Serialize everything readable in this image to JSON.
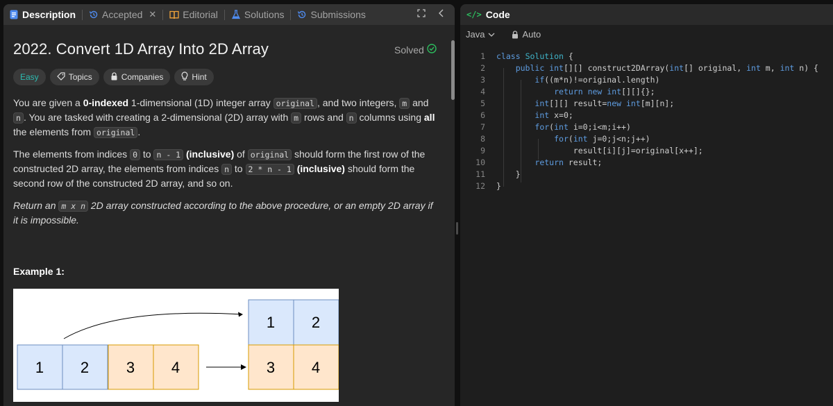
{
  "tabs": [
    {
      "label": "Description",
      "icon": "description-icon",
      "active": true
    },
    {
      "label": "Accepted",
      "icon": "history-icon",
      "active": false
    },
    {
      "label": "Editorial",
      "icon": "book-icon",
      "active": false
    },
    {
      "label": "Solutions",
      "icon": "flask-icon",
      "active": false
    },
    {
      "label": "Submissions",
      "icon": "history-icon",
      "active": false
    }
  ],
  "close_glyph": "✕",
  "problem": {
    "title": "2022. Convert 1D Array Into 2D Array",
    "status": "Solved",
    "chips": [
      "Easy",
      "Topics",
      "Companies",
      "Hint"
    ],
    "p1": {
      "t1": "You are given a ",
      "b1": "0-indexed",
      "t2": " 1-dimensional (1D) integer array ",
      "c1": "original",
      "t3": ", and two integers, ",
      "c2": "m",
      "t4": " and ",
      "c3": "n",
      "t5": ". You are tasked with creating a 2-dimensional (2D) array with ",
      "c4": "m",
      "t6": " rows and ",
      "c5": "n",
      "t7": " columns using ",
      "b2": "all",
      "t8": " the elements from ",
      "c6": "original",
      "t9": "."
    },
    "p2": {
      "t1": "The elements from indices ",
      "c1": "0",
      "t2": " to ",
      "c2": "n - 1",
      "t3": " ",
      "b1": "(inclusive)",
      "t4": " of ",
      "c3": "original",
      "t5": " should form the first row of the constructed 2D array, the elements from indices ",
      "c4": "n",
      "t6": " to ",
      "c5": "2 * n - 1",
      "t7": " ",
      "b2": "(inclusive)",
      "t8": " should form the second row of the constructed 2D array, and so on."
    },
    "p3": {
      "t1": "Return an ",
      "c1": "m x n",
      "t2": " 2D array constructed according to the above procedure, or an empty 2D array if it is impossible."
    },
    "example_title": "Example 1:",
    "example_image": {
      "input_cells": [
        "1",
        "2",
        "3",
        "4"
      ],
      "output_rows": [
        [
          "1",
          "2"
        ],
        [
          "3",
          "4"
        ]
      ],
      "colors": {
        "blue": "#dae8fc",
        "blue_border": "#6c8ebf",
        "orange": "#ffe6cc",
        "orange_border": "#d79b00"
      }
    }
  },
  "code_panel": {
    "title": "Code",
    "language": "Java",
    "mode": "Auto",
    "line_numbers": [
      "1",
      "2",
      "3",
      "4",
      "5",
      "6",
      "7",
      "8",
      "9",
      "10",
      "11",
      "12"
    ]
  },
  "colors": {
    "accent_green": "#2cbb5d",
    "easy_teal": "#2cbbb0",
    "keyword_blue": "#5e9ce0"
  }
}
